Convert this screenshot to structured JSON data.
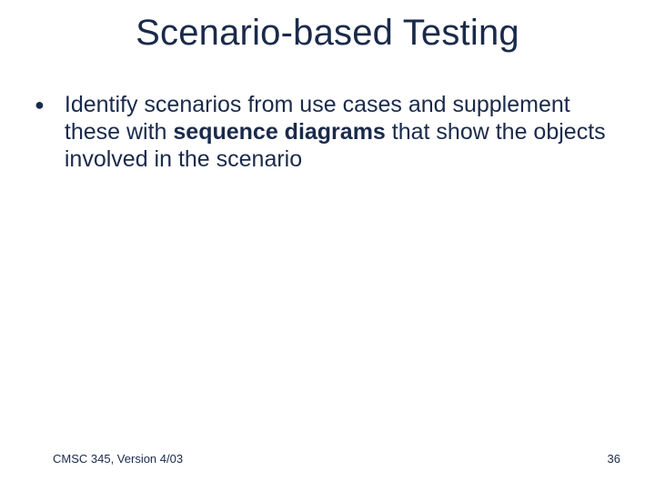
{
  "title": "Scenario-based Testing",
  "bullet": {
    "pre": "Identify scenarios from use cases and supplement these with ",
    "bold": "sequence diagrams",
    "post": " that show the objects involved in the scenario"
  },
  "footer": {
    "left": "CMSC 345, Version 4/03",
    "page": "36"
  }
}
